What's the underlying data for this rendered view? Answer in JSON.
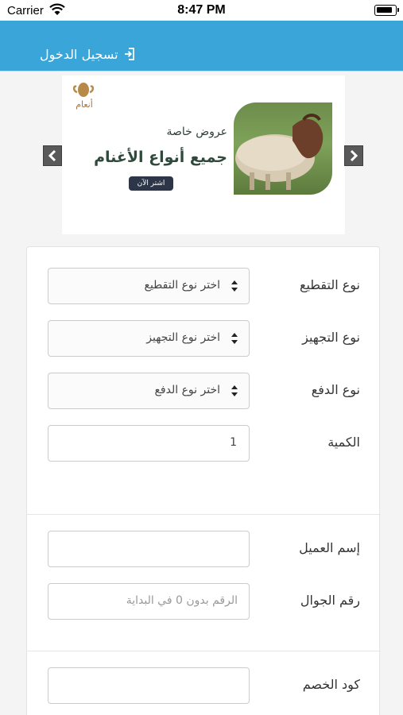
{
  "status_bar": {
    "carrier": "Carrier",
    "time": "8:47 PM"
  },
  "nav": {
    "login_label": "تسجيل الدخول"
  },
  "banner": {
    "logo_text": "أنعام",
    "offer_title": "عروض خاصة",
    "offer_subtitle": "جميع أنواع الأغنام",
    "button_label": "اشتر الآن"
  },
  "form": {
    "cutting": {
      "label": "نوع التقطيع",
      "value": "اختر نوع التقطيع"
    },
    "preparation": {
      "label": "نوع التجهيز",
      "value": "اختر نوع التجهيز"
    },
    "payment": {
      "label": "نوع الدفع",
      "value": "اختر نوع الدفع"
    },
    "quantity": {
      "label": "الكمية",
      "value": "1"
    },
    "customer_name": {
      "label": "إسم العميل",
      "value": ""
    },
    "mobile": {
      "label": "رقم الجوال",
      "placeholder": "الرقم بدون 0 في البداية"
    },
    "discount_code": {
      "label": "كود الخصم",
      "value": ""
    }
  },
  "colors": {
    "accent": "#3aa5d8",
    "card_bg": "#ffffff",
    "page_bg": "#f4f4f4"
  }
}
